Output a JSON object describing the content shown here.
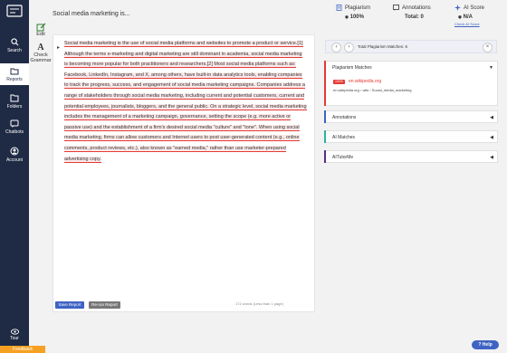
{
  "nav": {
    "items": [
      {
        "label": "Search"
      },
      {
        "label": "Reports"
      },
      {
        "label": "Folders"
      },
      {
        "label": "Chatbots"
      },
      {
        "label": "Account"
      }
    ],
    "tour_label": "Tour",
    "orange_tab_label": "Feedback"
  },
  "tools": {
    "edit_label": "Edit",
    "check_grammar_label": "Check Grammar"
  },
  "document": {
    "title": "Social media marketing is...",
    "segments": [
      {
        "text": "Social media marketing is the use of social media platforms and websites to promote a product or service.[1] ",
        "mark": "pl"
      },
      {
        "text": "Although the terms e-marketing and digital marketing are still dominant in academia, social media marketing is becoming more popular for both practitioners and researchers.[2] ",
        "mark": "pl"
      },
      {
        "text": "Most social media platforms such as: Facebook, LinkedIn, Instagram, and X, among others, have built-in data analytics tools, enabling companies to track the progress, success, and engagement of social media marketing campaigns. ",
        "mark": "pl"
      },
      {
        "text": "Companies address a range of stakeholders through social media marketing, including current and potential customers, current and potential employees, journalists, bloggers, and the general public. ",
        "mark": "pl"
      },
      {
        "text": "On a strategic level, social media marketing includes the management of a marketing campaign, governance, setting the scope (e.g. more active or passive use) and the establishment of a firm's desired social media \"culture\" and \"tone\". ",
        "mark": "pl"
      },
      {
        "text": "When using social media marketing, firms can allow customers and Internet users to post user-generated content (e.g., online comments, product reviews, etc.), also known as \"earned media,\" rather than use marketer-prepared advertising copy.",
        "mark": "pl"
      }
    ],
    "save_report_label": "Save Report",
    "rerun_report_label": "Re-run Report",
    "word_count": "172 words (Less than 1 page)"
  },
  "stats": {
    "plagiarism": {
      "label": "Plagiarism",
      "value": "100%"
    },
    "annotations": {
      "label": "Annotations",
      "value": "Total: 0"
    },
    "ai_score": {
      "label": "AI Score",
      "value": "N/A",
      "link": "Check AI Score"
    }
  },
  "matches_bar": {
    "label": "Total Plagiarism Matches: 6",
    "prev_icon": "chevron-left-icon",
    "next_icon": "chevron-right-icon"
  },
  "panels": {
    "plagiarism_matches": {
      "title": "Plagiarism Matches",
      "badge": "100%",
      "source_name": "en.wikipedia.org",
      "source_url": "en.wikipedia.org › wiki › Social_media_marketing"
    },
    "annotations_title": "Annotations",
    "ai_matches_title": "AI Matches",
    "aitutorme_title": "AITutorMe"
  },
  "colors": {
    "nav_bg": "#1f2a44",
    "accent": "#3f63c3",
    "danger": "#e53935",
    "annotations_bar": "#3f63c3",
    "ai_bar": "#2bb3a0",
    "aitutor_bar": "#5b2c83"
  },
  "help_label": "Help"
}
